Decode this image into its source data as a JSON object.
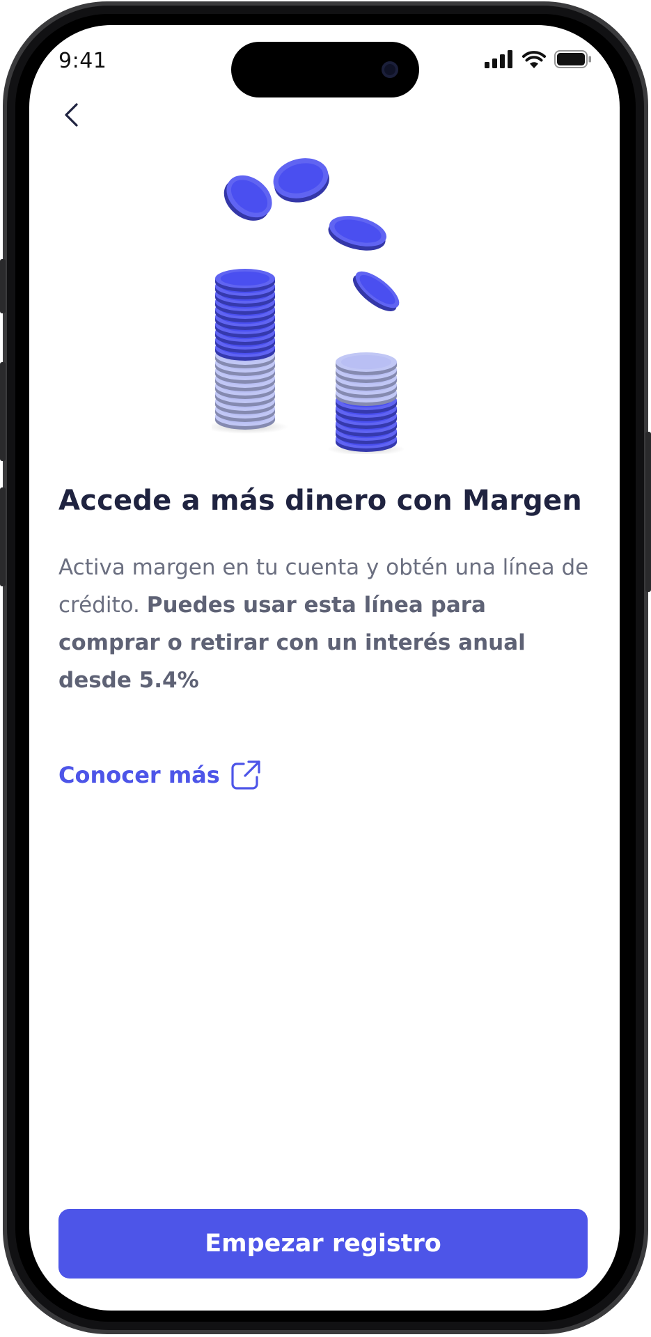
{
  "status_bar": {
    "time": "9:41",
    "icons": [
      "signal-bars-icon",
      "wifi-icon",
      "battery-icon"
    ]
  },
  "nav": {
    "back_icon": "chevron-left-icon"
  },
  "hero": {
    "illustration": "coin-stacks-illustration",
    "coin_colors": {
      "dark": "#4a4ff0",
      "light": "#b9bff4"
    }
  },
  "content": {
    "title": "Accede a más dinero con Margen",
    "description_regular": "Activa margen en tu cuenta y obtén una línea de crédito.",
    "description_bold": "Puedes usar esta línea para comprar o retirar con un interés anual desde 5.4%",
    "learn_more_label": "Conocer más",
    "learn_more_icon": "external-link-icon"
  },
  "actions": {
    "primary_label": "Empezar registro"
  },
  "theme": {
    "accent": "#4d55e8",
    "title_color": "#1f2340",
    "body_color": "#6b6f80"
  }
}
